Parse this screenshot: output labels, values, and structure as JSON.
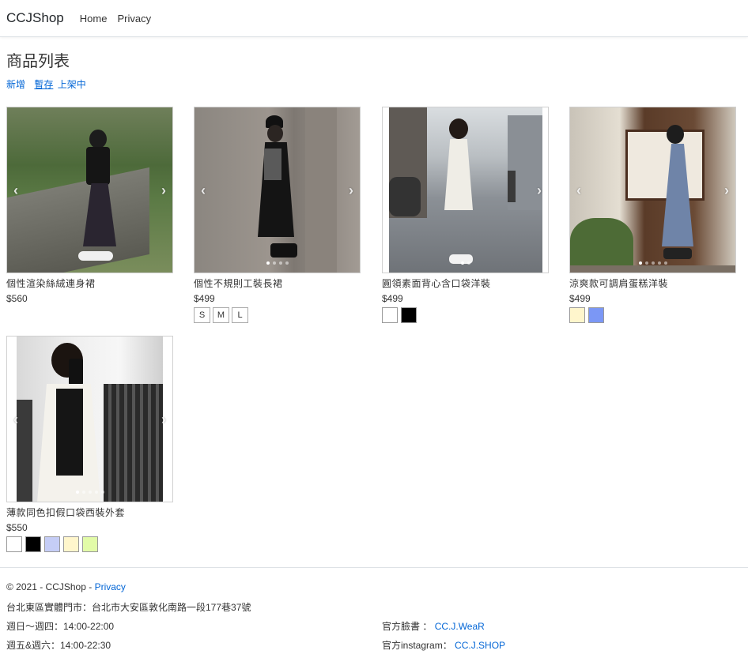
{
  "nav": {
    "brand": "CCJShop",
    "links": [
      "Home",
      "Privacy"
    ]
  },
  "page": {
    "title": "商品列表",
    "actions": {
      "new": "新增",
      "draft": "暫存",
      "on_shelf": "上架中"
    }
  },
  "carousel": {
    "prev_icon": "chevron-left-icon",
    "next_icon": "chevron-right-icon"
  },
  "products": [
    {
      "name": "個性渲染絲絨連身裙",
      "price": "$560",
      "sizes": [],
      "colors": []
    },
    {
      "name": "個性不規則工裝長裙",
      "price": "$499",
      "sizes": [
        "S",
        "M",
        "L"
      ],
      "colors": []
    },
    {
      "name": "圓領素面背心含口袋洋裝",
      "price": "$499",
      "sizes": [],
      "colors": [
        "#ffffff",
        "#000000"
      ]
    },
    {
      "name": "涼爽款可調肩蛋糕洋裝",
      "price": "$499",
      "sizes": [],
      "colors": [
        "#fff6cc",
        "#7b97f5"
      ]
    },
    {
      "name": "薄款同色扣假口袋西裝外套",
      "price": "$550",
      "sizes": [],
      "colors": [
        "#ffffff",
        "#000000",
        "#c5cdf6",
        "#fff6cc",
        "#e2fba8"
      ]
    }
  ],
  "footer": {
    "copyright": "© 2021 - CCJShop -",
    "privacy_link": "Privacy",
    "store_address": "台北東區實體門市：台北市大安區敦化南路一段177巷37號",
    "hours_weekday": "週日～週四：14:00-22:00",
    "hours_weekend": "週五&週六：14:00-22:30",
    "facebook_label": "官方臉書 ：",
    "facebook_link": "CC.J.WeaR",
    "instagram_label": "官方instagram：",
    "instagram_link": "CC.J.SHOP"
  }
}
